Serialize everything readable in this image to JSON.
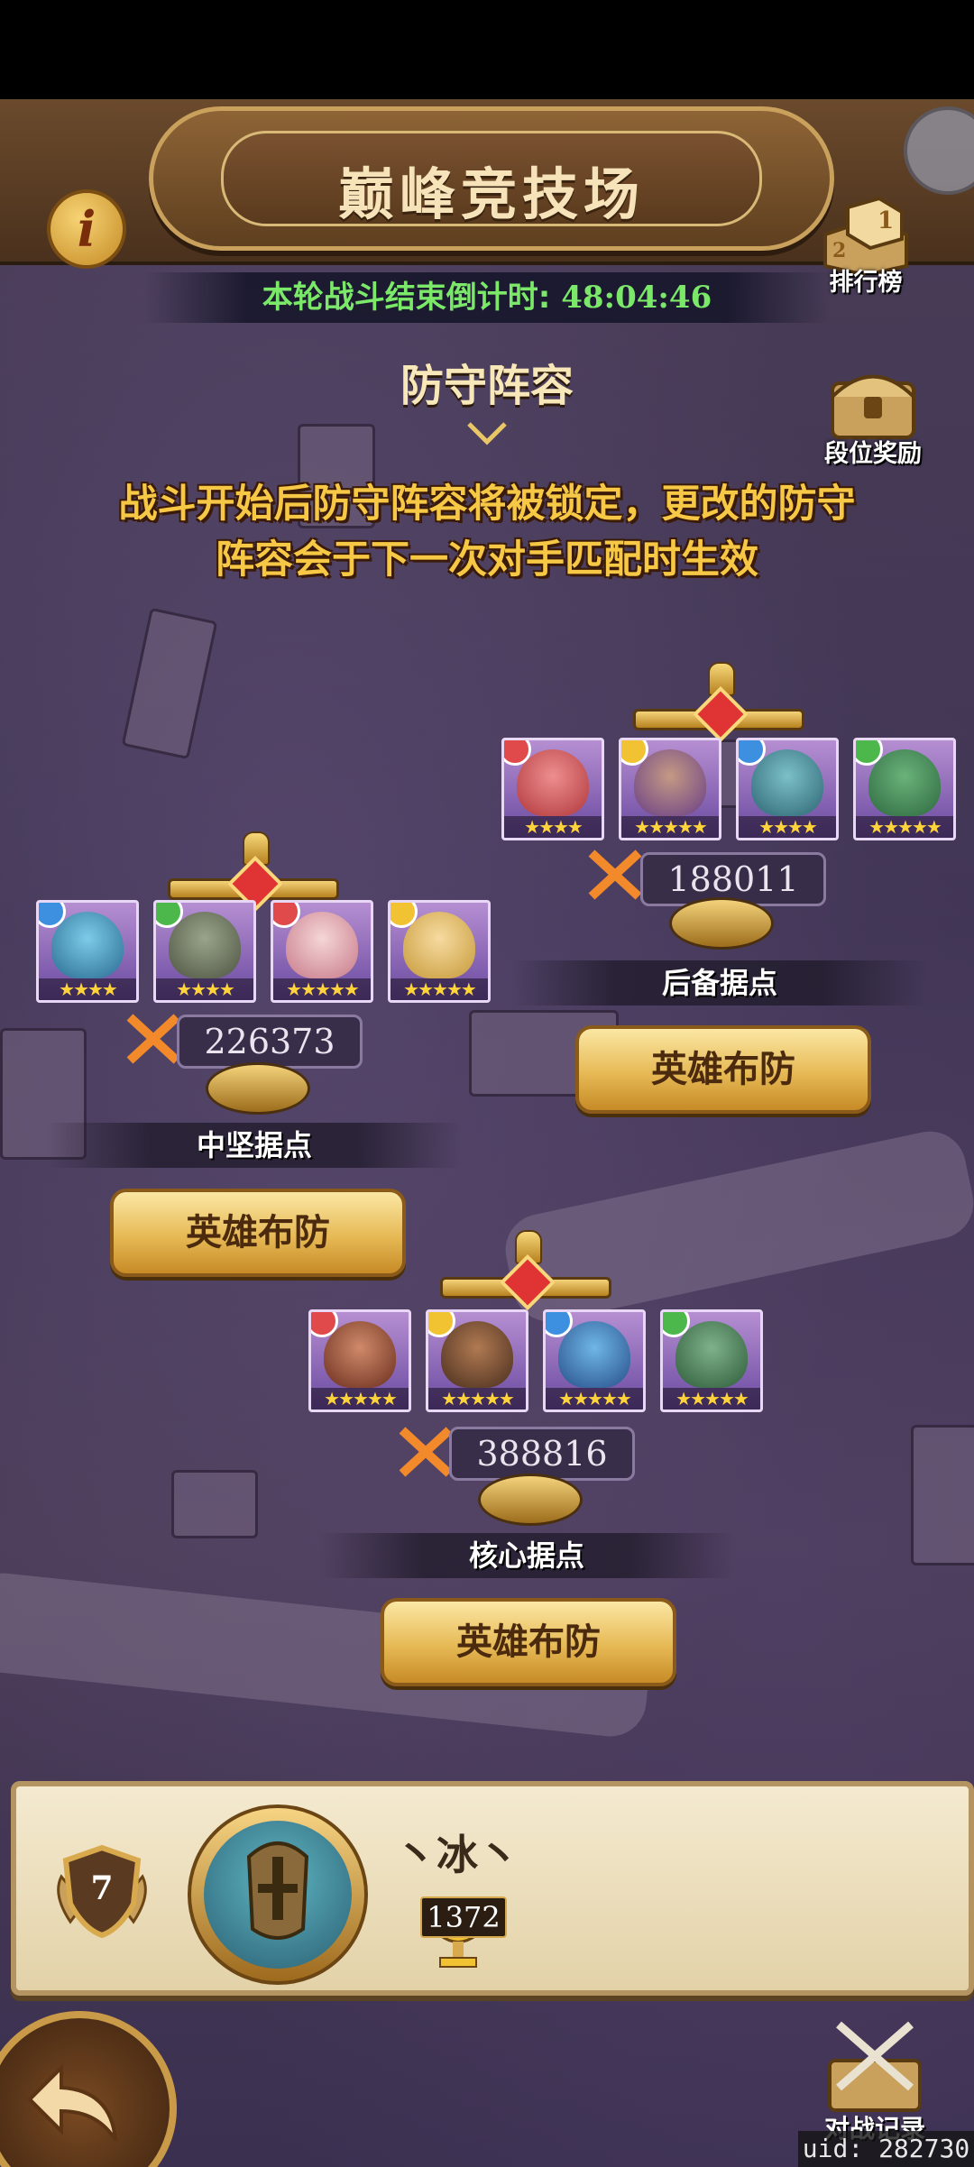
{
  "header": {
    "title": "巅峰竞技场",
    "info_icon": "info-icon",
    "countdown_label": "本轮战斗结束倒计时:",
    "countdown_time": "48:04:46"
  },
  "side_buttons": {
    "ranking_label": "排行榜",
    "rank_reward_label": "段位奖励",
    "battle_record_label": "对战记录"
  },
  "section": {
    "title": "防守阵容",
    "notice_line1": "战斗开始后防守阵容将被锁定，更改的防守",
    "notice_line2": "阵容会于下一次对手匹配时生效"
  },
  "stations": [
    {
      "id": "reserve",
      "name": "后备据点",
      "power": "188011",
      "button_label": "英雄布防",
      "heroes": [
        {
          "element": "red",
          "stars": "★★★★"
        },
        {
          "element": "gold",
          "stars": "★★★★★"
        },
        {
          "element": "blue",
          "stars": "★★★★"
        },
        {
          "element": "green",
          "stars": "★★★★★"
        }
      ]
    },
    {
      "id": "middle",
      "name": "中坚据点",
      "power": "226373",
      "button_label": "英雄布防",
      "heroes": [
        {
          "element": "blue",
          "stars": "★★★★"
        },
        {
          "element": "green",
          "stars": "★★★★"
        },
        {
          "element": "red",
          "stars": "★★★★★"
        },
        {
          "element": "gold",
          "stars": "★★★★★"
        }
      ]
    },
    {
      "id": "core",
      "name": "核心据点",
      "power": "388816",
      "button_label": "英雄布防",
      "heroes": [
        {
          "element": "red",
          "stars": "★★★★★"
        },
        {
          "element": "gold",
          "stars": "★★★★★"
        },
        {
          "element": "blue",
          "stars": "★★★★★"
        },
        {
          "element": "green",
          "stars": "★★★★★"
        }
      ]
    }
  ],
  "player": {
    "rank_level": "7",
    "name": "丶冰丶",
    "trophies": "1372"
  },
  "footer": {
    "uid": "uid: 282730"
  },
  "colors": {
    "countdown_text": "#7be86a",
    "notice_text": "#f6c845",
    "element_red": "#e04a4a",
    "element_gold": "#f1c232",
    "element_blue": "#3d8fe0",
    "element_green": "#4cb84c"
  }
}
